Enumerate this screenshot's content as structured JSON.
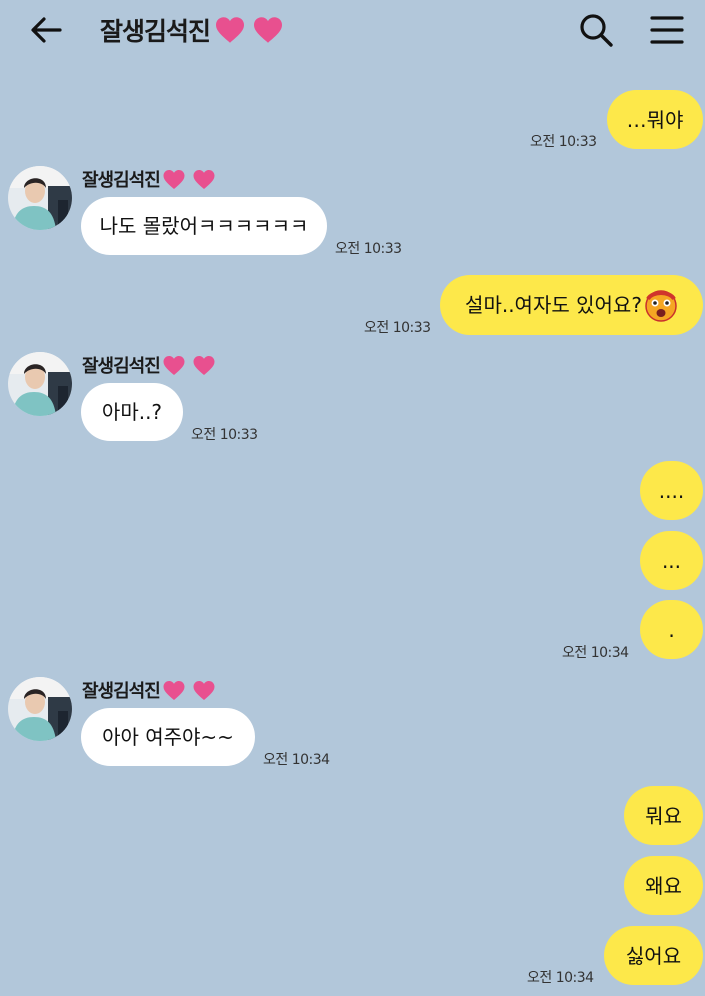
{
  "header": {
    "title": "잘생김석진",
    "title_hearts": [
      "heart-icon",
      "heart-icon"
    ],
    "back_icon": "arrow-left-icon",
    "search_icon": "search-icon",
    "menu_icon": "hamburger-menu-icon"
  },
  "colors": {
    "background": "#b2c7da",
    "my_bubble": "#fde84a",
    "their_bubble": "#ffffff",
    "heart": "#e8508f"
  },
  "messages": [
    {
      "from": "me",
      "text": "…뭐야",
      "time": "오전 10:33"
    },
    {
      "from": "them",
      "sender": "잘생김석진",
      "text": "나도 몰랐어ㅋㅋㅋㅋㅋㅋ",
      "time": "오전 10:33"
    },
    {
      "from": "me",
      "text": "설마..여자도 있어요?",
      "emoji": "shocked-face-icon",
      "time": "오전 10:33"
    },
    {
      "from": "them",
      "sender": "잘생김석진",
      "text": "아마..?",
      "time": "오전 10:33"
    },
    {
      "from": "me",
      "text": "....",
      "time": ""
    },
    {
      "from": "me",
      "text": "...",
      "time": ""
    },
    {
      "from": "me",
      "text": ".",
      "time": "오전 10:34"
    },
    {
      "from": "them",
      "sender": "잘생김석진",
      "text": "아아 여주야~~",
      "time": "오전 10:34"
    },
    {
      "from": "me",
      "text": "뭐요",
      "time": ""
    },
    {
      "from": "me",
      "text": "왜요",
      "time": ""
    },
    {
      "from": "me",
      "text": "싫어요",
      "time": "오전 10:34"
    }
  ]
}
